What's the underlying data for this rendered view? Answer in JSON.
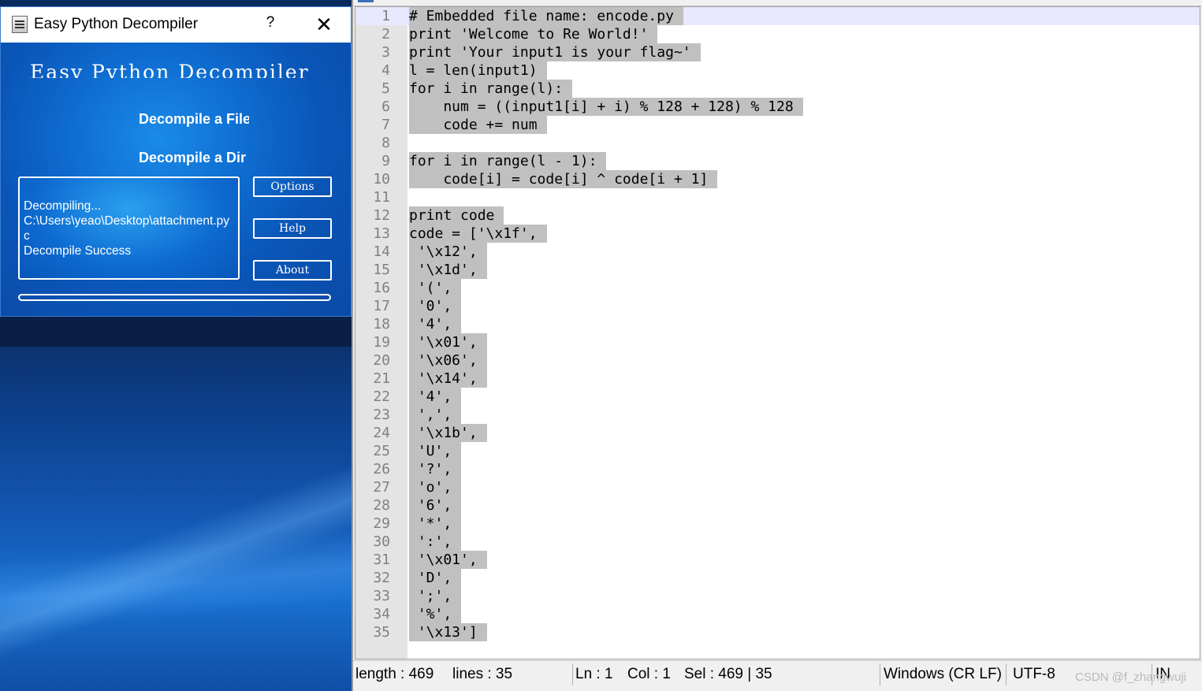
{
  "decompiler": {
    "title": "Easy Python Decompiler",
    "help_button": "?",
    "close_button": "✕",
    "banner": "Easy Python Decompiler",
    "link_file": "Decompile a File",
    "link_dir": "Decompile a Dir",
    "log_lines": [
      "Decompiling...",
      "C:\\Users\\yeao\\Desktop\\attachment.py",
      "c",
      "Decompile Success"
    ],
    "buttons": {
      "options": "Options",
      "help": "Help",
      "about": "About"
    }
  },
  "editor": {
    "lines": [
      {
        "n": "1",
        "text": "# Embedded file name: encode.py"
      },
      {
        "n": "2",
        "text": "print 'Welcome to Re World!'"
      },
      {
        "n": "3",
        "text": "print 'Your input1 is your flag~'"
      },
      {
        "n": "4",
        "text": "l = len(input1)"
      },
      {
        "n": "5",
        "text": "for i in range(l):"
      },
      {
        "n": "6",
        "text": "    num = ((input1[i] + i) % 128 + 128) % 128"
      },
      {
        "n": "7",
        "text": "    code += num"
      },
      {
        "n": "8",
        "text": ""
      },
      {
        "n": "9",
        "text": "for i in range(l - 1):"
      },
      {
        "n": "10",
        "text": "    code[i] = code[i] ^ code[i + 1]"
      },
      {
        "n": "11",
        "text": ""
      },
      {
        "n": "12",
        "text": "print code"
      },
      {
        "n": "13",
        "text": "code = ['\\x1f',"
      },
      {
        "n": "14",
        "text": " '\\x12',"
      },
      {
        "n": "15",
        "text": " '\\x1d',"
      },
      {
        "n": "16",
        "text": " '(',"
      },
      {
        "n": "17",
        "text": " '0',"
      },
      {
        "n": "18",
        "text": " '4',"
      },
      {
        "n": "19",
        "text": " '\\x01',"
      },
      {
        "n": "20",
        "text": " '\\x06',"
      },
      {
        "n": "21",
        "text": " '\\x14',"
      },
      {
        "n": "22",
        "text": " '4',"
      },
      {
        "n": "23",
        "text": " ',',"
      },
      {
        "n": "24",
        "text": " '\\x1b',"
      },
      {
        "n": "25",
        "text": " 'U',"
      },
      {
        "n": "26",
        "text": " '?',"
      },
      {
        "n": "27",
        "text": " 'o',"
      },
      {
        "n": "28",
        "text": " '6',"
      },
      {
        "n": "29",
        "text": " '*',"
      },
      {
        "n": "30",
        "text": " ':',"
      },
      {
        "n": "31",
        "text": " '\\x01',"
      },
      {
        "n": "32",
        "text": " 'D',"
      },
      {
        "n": "33",
        "text": " ';',"
      },
      {
        "n": "34",
        "text": " '%',"
      },
      {
        "n": "35",
        "text": " '\\x13']"
      }
    ],
    "status": {
      "length": "length : 469",
      "lines": "lines : 35",
      "ln": "Ln : 1",
      "col": "Col : 1",
      "sel": "Sel : 469 | 35",
      "eol": "Windows (CR LF)",
      "encoding": "UTF-8",
      "mode": "IN"
    },
    "watermark": "CSDN @f_zhangwuji"
  }
}
